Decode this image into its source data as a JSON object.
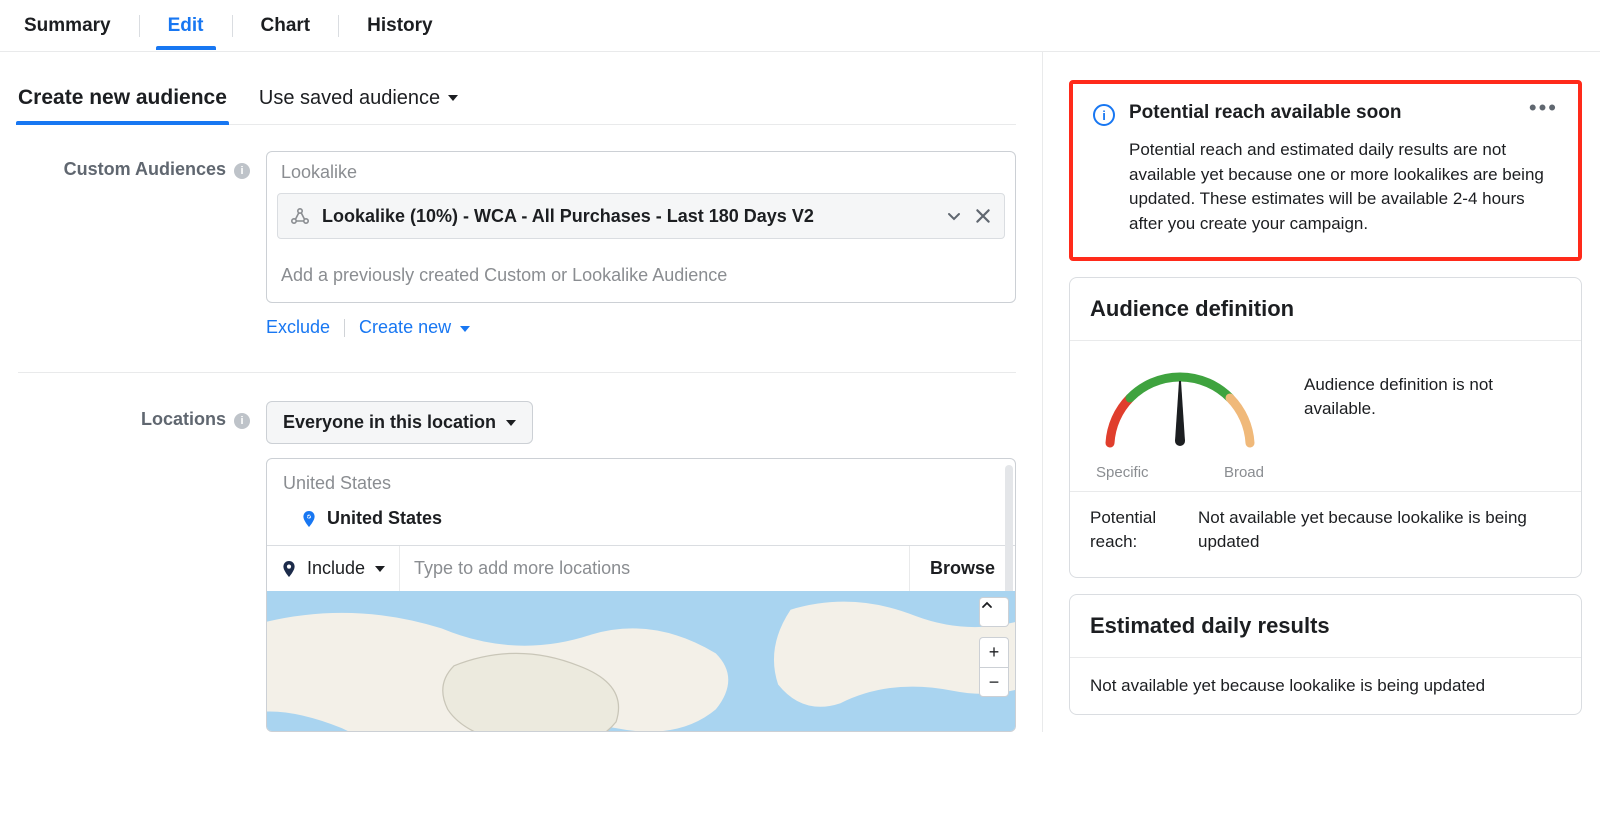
{
  "tabs": {
    "summary": "Summary",
    "edit": "Edit",
    "chart": "Chart",
    "history": "History"
  },
  "audience_tabs": {
    "create": "Create new audience",
    "saved": "Use saved audience"
  },
  "custom_audiences": {
    "label": "Custom Audiences",
    "group_label": "Lookalike",
    "chip": "Lookalike (10%) - WCA - All Purchases - Last 180 Days V2",
    "placeholder": "Add a previously created Custom or Lookalike Audience",
    "exclude": "Exclude",
    "create_new": "Create new"
  },
  "locations": {
    "label": "Locations",
    "scope": "Everyone in this location",
    "group_label": "United States",
    "item": "United States",
    "include": "Include",
    "input_placeholder": "Type to add more locations",
    "browse": "Browse"
  },
  "reach_card": {
    "title": "Potential reach available soon",
    "body": "Potential reach and estimated daily results are not available yet because one or more lookalikes are being updated. These estimates will be available 2-4 hours after you create your campaign."
  },
  "audience_def": {
    "title": "Audience definition",
    "specific": "Specific",
    "broad": "Broad",
    "text": "Audience definition is not available.",
    "pr_label": "Potential reach:",
    "pr_value": "Not available yet because lookalike is being updated"
  },
  "edr": {
    "title": "Estimated daily results",
    "body": "Not available yet because lookalike is being updated"
  }
}
